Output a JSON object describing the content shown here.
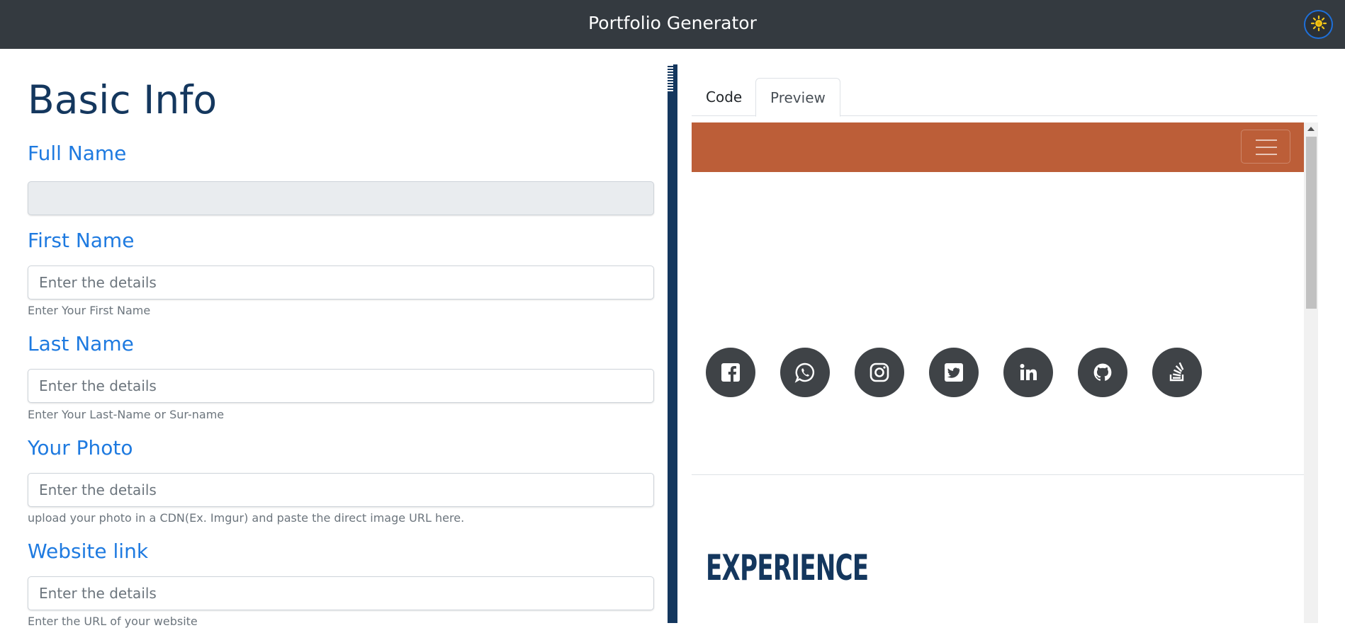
{
  "header": {
    "title": "Portfolio Generator",
    "theme_icon": "sun-icon"
  },
  "form": {
    "section_title": "Basic Info",
    "fields": [
      {
        "label": "Full Name",
        "placeholder": "",
        "help": ""
      },
      {
        "label": "First Name",
        "placeholder": "Enter the details",
        "help": "Enter Your First Name"
      },
      {
        "label": "Last Name",
        "placeholder": "Enter the details",
        "help": "Enter Your Last-Name or Sur-name"
      },
      {
        "label": "Your Photo",
        "placeholder": "Enter the details",
        "help": "upload your photo in a CDN(Ex. Imgur) and paste the direct image URL here."
      },
      {
        "label": "Website link",
        "placeholder": "Enter the details",
        "help": "Enter the URL of your website"
      }
    ]
  },
  "tabs": {
    "code": "Code",
    "preview": "Preview",
    "active": "Preview"
  },
  "preview": {
    "nav_color": "#bc5e38",
    "social_icons": [
      "facebook-icon",
      "whatsapp-icon",
      "instagram-icon",
      "twitter-icon",
      "linkedin-icon",
      "github-icon",
      "stackoverflow-icon"
    ],
    "experience_heading": "EXPERIENCE"
  },
  "colors": {
    "topbar": "#343a40",
    "accent_blue": "#1e7ae0",
    "navy": "#14375e"
  }
}
